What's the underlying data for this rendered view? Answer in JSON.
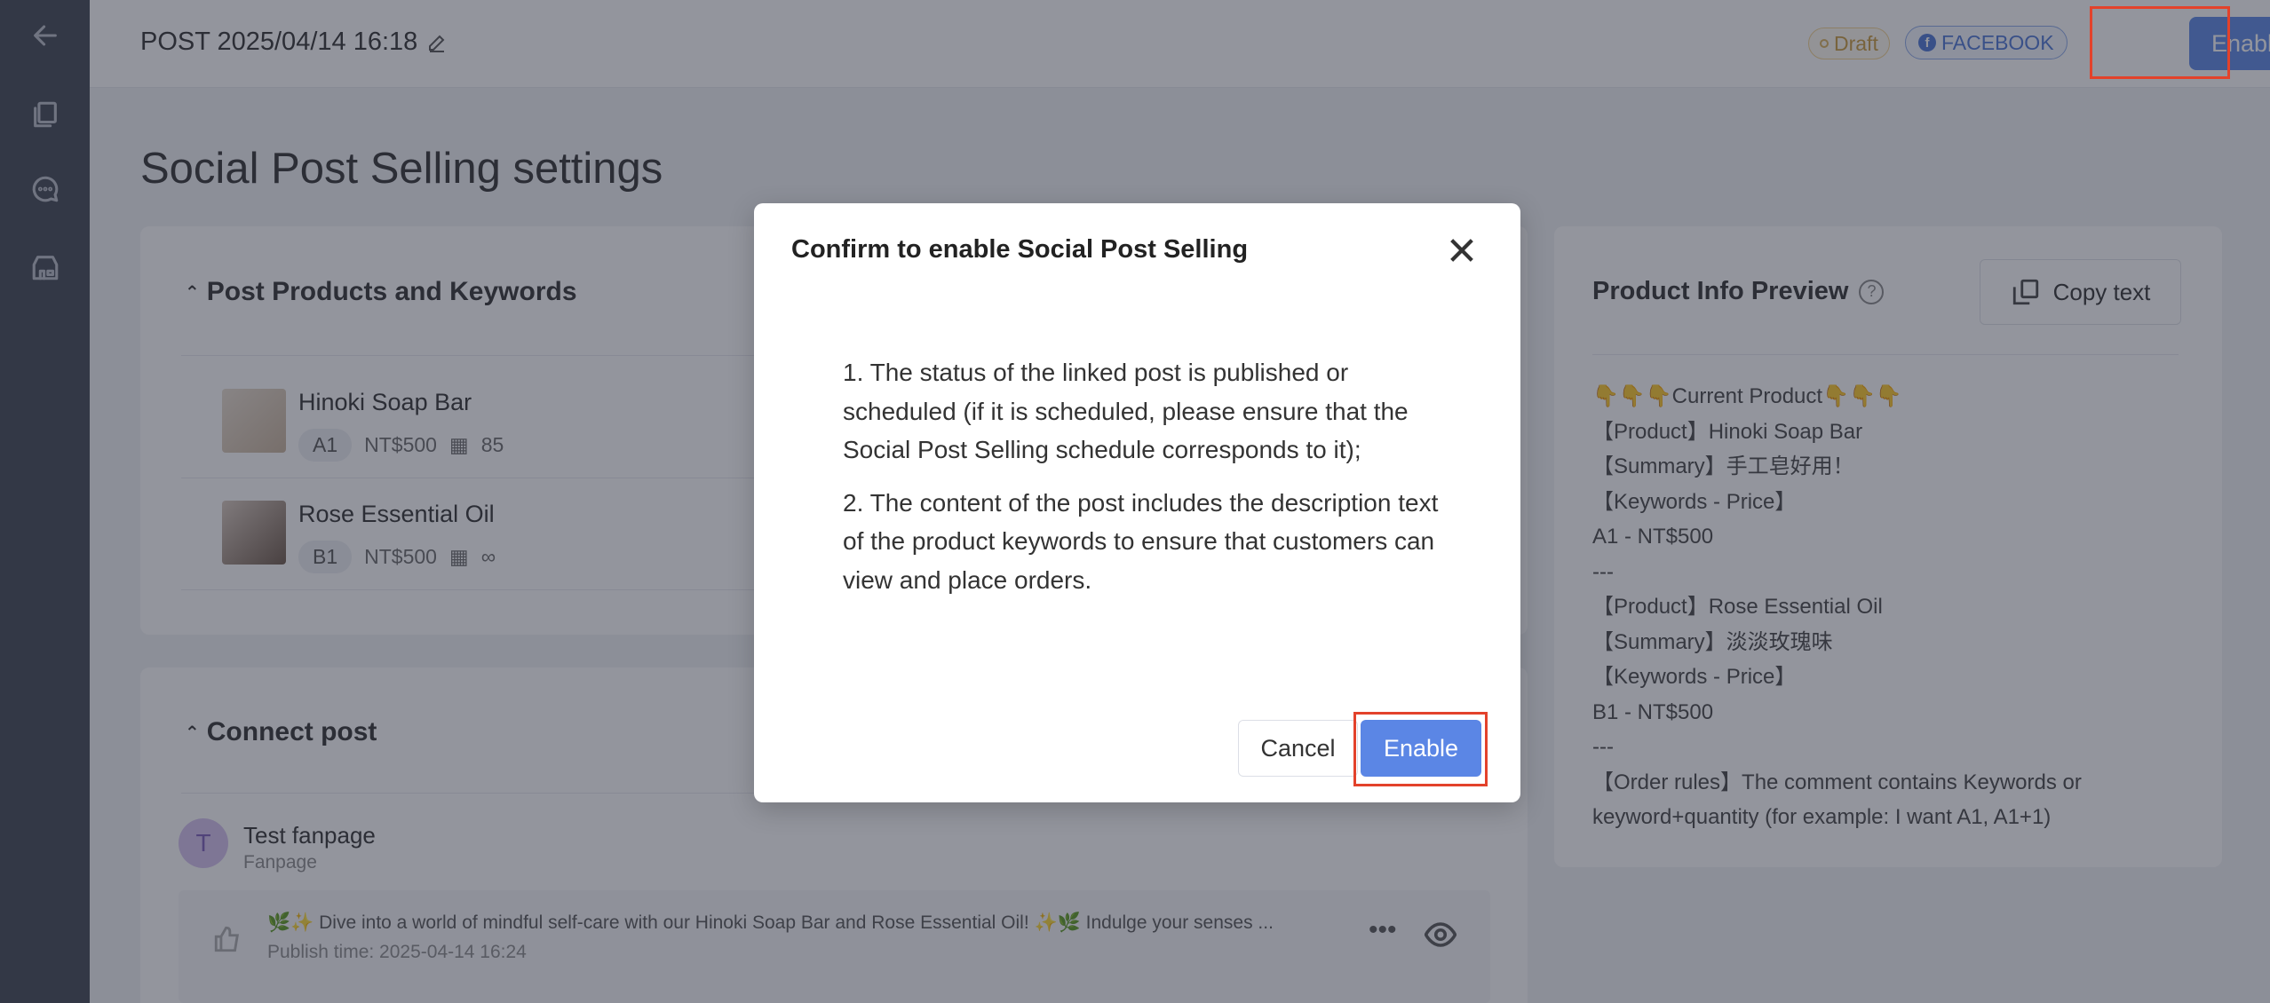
{
  "header": {
    "post_title": "POST 2025/04/14 16:18",
    "status_badge": "Draft",
    "platform_badge": "FACEBOOK",
    "enable_label": "Enable"
  },
  "sidebar": {
    "icons": [
      "back-arrow-icon",
      "post-icon",
      "chat-icon",
      "store-icon"
    ]
  },
  "page_title": "Social Post Selling settings",
  "products_section": {
    "title": "Post Products and Keywords",
    "products": [
      {
        "name": "Hinoki Soap Bar",
        "keyword": "A1",
        "price": "NT$500",
        "stock": "85"
      },
      {
        "name": "Rose Essential Oil",
        "keyword": "B1",
        "price": "NT$500",
        "stock": "∞"
      }
    ]
  },
  "connect_section": {
    "title": "Connect post",
    "page_name": "Test fanpage",
    "page_type": "Fanpage",
    "post_text": "🌿✨ Dive into a world of mindful self-care with our Hinoki Soap Bar and Rose Essential Oil! ✨🌿 Indulge your senses ...",
    "publish_time": "Publish time: 2025-04-14 16:24"
  },
  "preview": {
    "title": "Product Info Preview",
    "copy_label": "Copy text",
    "lines": [
      "👇👇👇Current Product👇👇👇",
      "【Product】Hinoki Soap Bar",
      "【Summary】手工皂好用！",
      "【Keywords - Price】",
      "A1 - NT$500",
      "---",
      "【Product】Rose Essential Oil",
      "【Summary】淡淡玫瑰味",
      "【Keywords - Price】",
      "B1 - NT$500",
      "---",
      "【Order rules】The comment contains Keywords or",
      "keyword+quantity (for example: I want A1, A1+1)"
    ]
  },
  "modal": {
    "title": "Confirm to enable Social Post Selling",
    "item1": "1. The status of the linked post is published or scheduled (if it is scheduled, please ensure that the Social Post Selling schedule corresponds to it);",
    "item2": "2. The content of the post includes the description text of the product keywords to ensure that customers can view and place orders.",
    "cancel_label": "Cancel",
    "enable_label": "Enable"
  },
  "colors": {
    "accent": "#5b86e5",
    "highlight": "#e3422b",
    "sidebar": "#3f4451"
  }
}
